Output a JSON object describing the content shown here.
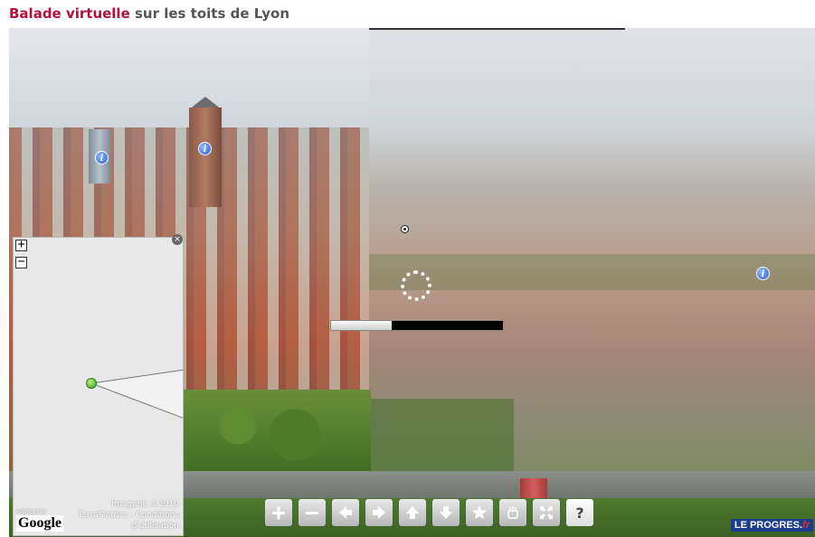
{
  "header": {
    "title_accent": "Balade virtuelle",
    "title_rest": " sur les toits de Lyon"
  },
  "viewer": {
    "loading_progress": 0.35,
    "hotspots": [
      {
        "name": "info-icon",
        "label": "i"
      },
      {
        "name": "info-icon",
        "label": "i"
      },
      {
        "name": "info-icon",
        "label": "i"
      }
    ]
  },
  "map": {
    "zoom_in_label": "+",
    "zoom_out_label": "−",
    "close_label": "×",
    "powered_by": "POWERED BY",
    "google_logo": "Google",
    "credits_line1": "Imagerie ©2010",
    "credits_line2": "TerraMetrics - Conditions",
    "credits_line3": "d'utilisation"
  },
  "toolbar": {
    "help_label": "?"
  },
  "brand": {
    "logo_text": "LE PROGRES.",
    "logo_suffix": "fr"
  },
  "colors": {
    "accent": "#b0103a",
    "title_gray": "#555555"
  }
}
